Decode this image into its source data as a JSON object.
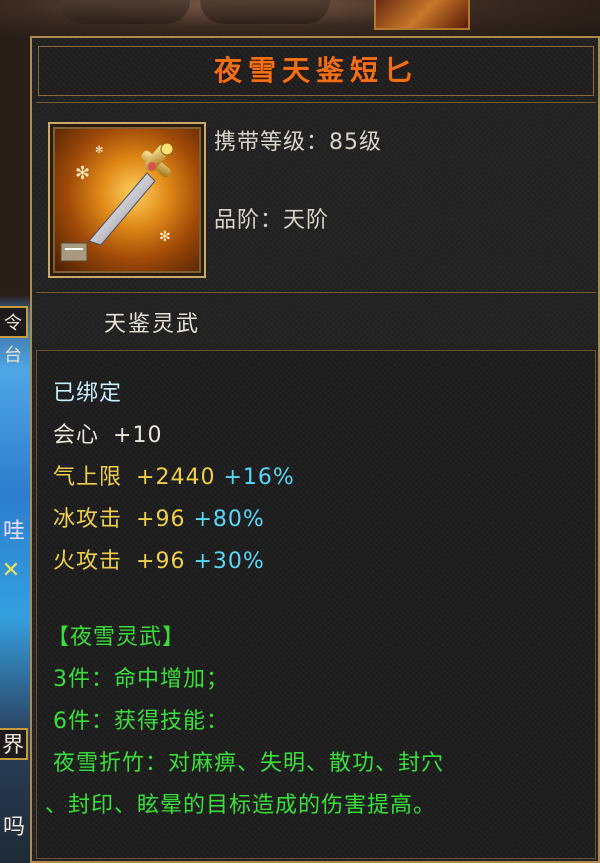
{
  "item": {
    "name": "夜雪天鉴短匕",
    "carry_level_label": "携带等级：",
    "carry_level_value": "85级",
    "grade_label": "品阶：",
    "grade_value": "天阶",
    "icon": "golden-dagger-icon"
  },
  "subtitle": "天鉴灵武",
  "status": "已绑定",
  "stats": [
    {
      "name": "会心",
      "value": "+10",
      "bonus": ""
    },
    {
      "name": "气上限",
      "value": "+2440",
      "bonus": "+16%"
    },
    {
      "name": "冰攻击",
      "value": "+96",
      "bonus": "+80%"
    },
    {
      "name": "火攻击",
      "value": "+96",
      "bonus": "+30%"
    }
  ],
  "set": {
    "title": "【夜雪灵武】",
    "bonus_3": "3件：命中增加；",
    "bonus_6": "6件：获得技能：",
    "skill_line1": "夜雪折竹：对麻痹、失明、散功、封穴",
    "skill_line2": "、封印、眩晕的目标造成的伤害提高。"
  },
  "background": {
    "left_texts": [
      "令台",
      "哇",
      "界",
      "吗"
    ]
  },
  "colors": {
    "title": "#f07018",
    "stat_white": "#e8e4dc",
    "stat_yellow": "#f0d048",
    "stat_cyan": "#58d8f8",
    "status_cyan": "#c8f0ff",
    "set_green": "#38e038",
    "border_gold": "#b08a4a"
  }
}
